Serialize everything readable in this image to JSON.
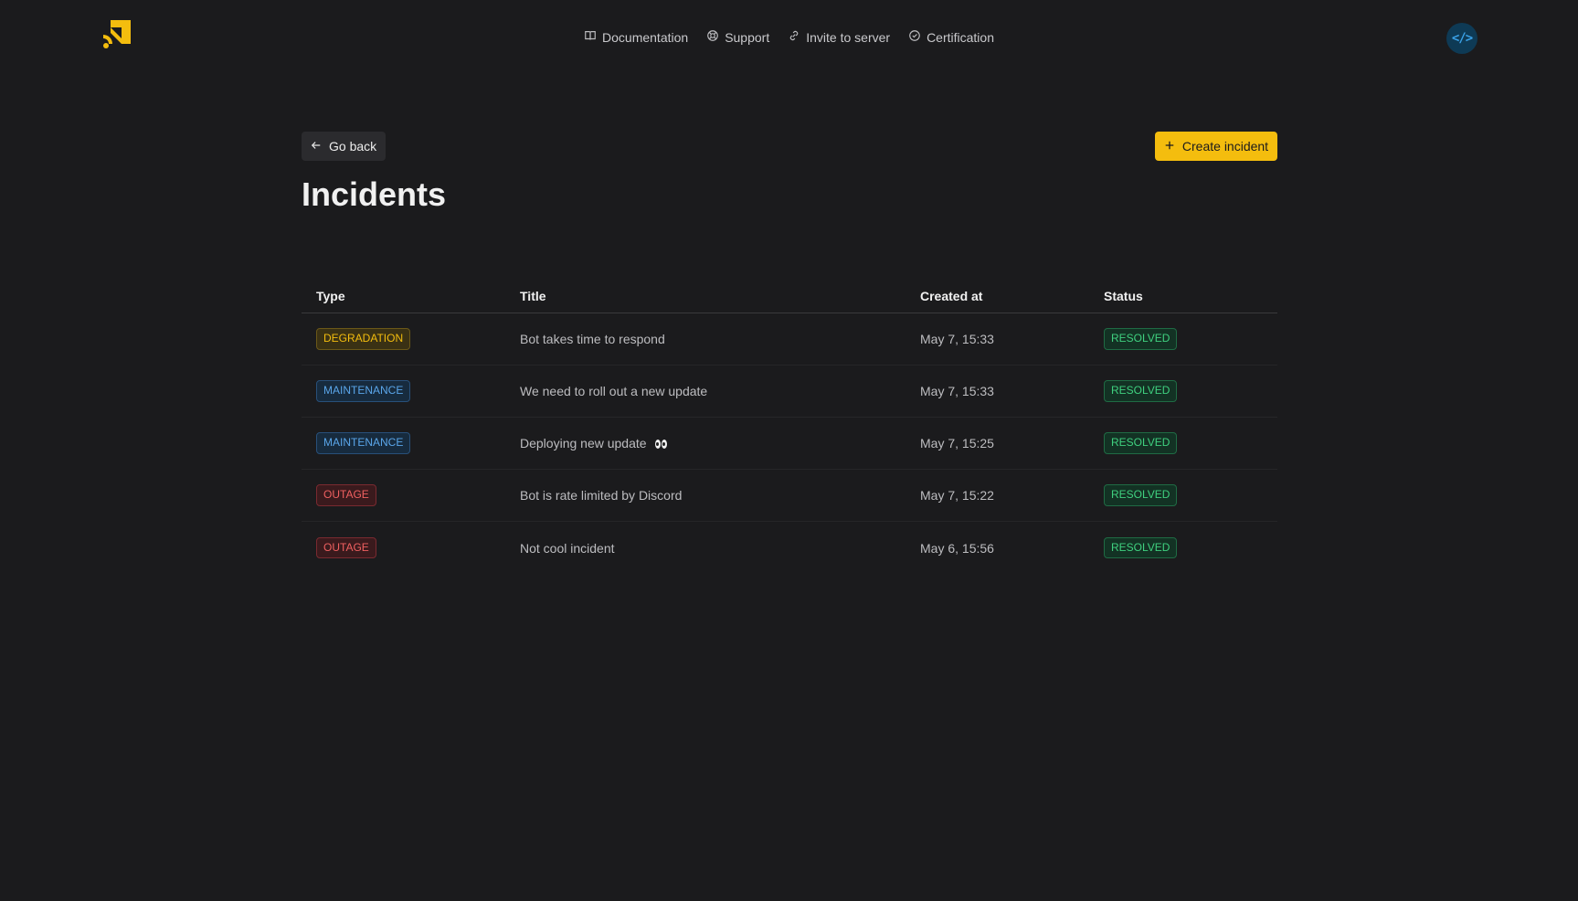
{
  "nav": {
    "items": [
      {
        "label": "Documentation",
        "icon": "book-icon"
      },
      {
        "label": "Support",
        "icon": "lifebuoy-icon"
      },
      {
        "label": "Invite to server",
        "icon": "link-icon"
      },
      {
        "label": "Certification",
        "icon": "check-circle-icon"
      }
    ]
  },
  "page": {
    "go_back_label": "Go back",
    "create_label": "Create incident",
    "title": "Incidents"
  },
  "table": {
    "headers": {
      "type": "Type",
      "title": "Title",
      "created": "Created at",
      "status": "Status"
    },
    "rows": [
      {
        "type": "DEGRADATION",
        "title": "Bot takes time to respond",
        "created": "May 7, 15:33",
        "status": "RESOLVED"
      },
      {
        "type": "MAINTENANCE",
        "title": "We need to roll out a new update",
        "created": "May 7, 15:33",
        "status": "RESOLVED"
      },
      {
        "type": "MAINTENANCE",
        "title": "Deploying new update",
        "created": "May 7, 15:25",
        "status": "RESOLVED"
      },
      {
        "type": "OUTAGE",
        "title": "Bot is rate limited by Discord",
        "created": "May 7, 15:22",
        "status": "RESOLVED"
      },
      {
        "type": "OUTAGE",
        "title": "Not cool incident",
        "created": "May 6, 15:56",
        "status": "RESOLVED"
      }
    ]
  },
  "colors": {
    "background": "#1b1b1d",
    "accent": "#f4bd0e",
    "degradation": "#f4bd0e",
    "maintenance": "#5aa6ea",
    "outage": "#ef6060",
    "resolved": "#3fd07f"
  }
}
